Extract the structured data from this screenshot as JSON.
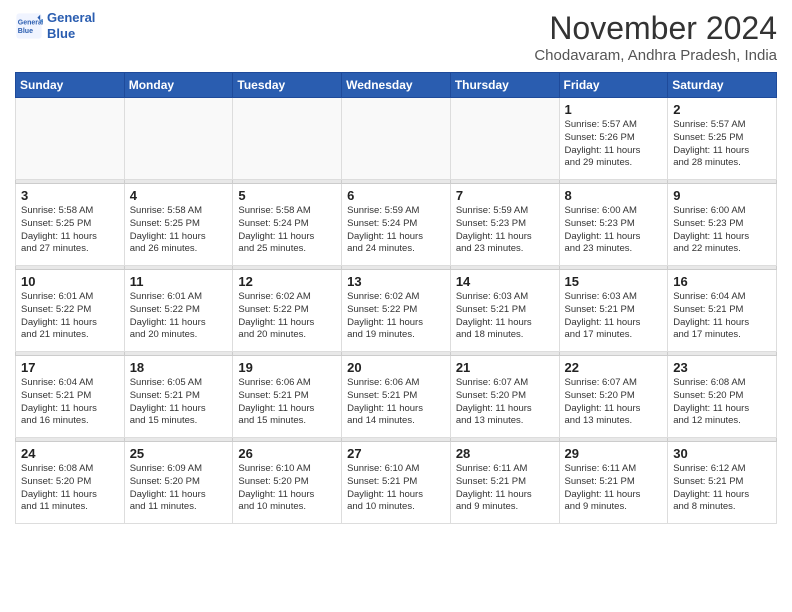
{
  "header": {
    "logo_line1": "General",
    "logo_line2": "Blue",
    "month_year": "November 2024",
    "location": "Chodavaram, Andhra Pradesh, India"
  },
  "weekdays": [
    "Sunday",
    "Monday",
    "Tuesday",
    "Wednesday",
    "Thursday",
    "Friday",
    "Saturday"
  ],
  "weeks": [
    [
      {
        "day": "",
        "info": ""
      },
      {
        "day": "",
        "info": ""
      },
      {
        "day": "",
        "info": ""
      },
      {
        "day": "",
        "info": ""
      },
      {
        "day": "",
        "info": ""
      },
      {
        "day": "1",
        "info": "Sunrise: 5:57 AM\nSunset: 5:26 PM\nDaylight: 11 hours\nand 29 minutes."
      },
      {
        "day": "2",
        "info": "Sunrise: 5:57 AM\nSunset: 5:25 PM\nDaylight: 11 hours\nand 28 minutes."
      }
    ],
    [
      {
        "day": "3",
        "info": "Sunrise: 5:58 AM\nSunset: 5:25 PM\nDaylight: 11 hours\nand 27 minutes."
      },
      {
        "day": "4",
        "info": "Sunrise: 5:58 AM\nSunset: 5:25 PM\nDaylight: 11 hours\nand 26 minutes."
      },
      {
        "day": "5",
        "info": "Sunrise: 5:58 AM\nSunset: 5:24 PM\nDaylight: 11 hours\nand 25 minutes."
      },
      {
        "day": "6",
        "info": "Sunrise: 5:59 AM\nSunset: 5:24 PM\nDaylight: 11 hours\nand 24 minutes."
      },
      {
        "day": "7",
        "info": "Sunrise: 5:59 AM\nSunset: 5:23 PM\nDaylight: 11 hours\nand 23 minutes."
      },
      {
        "day": "8",
        "info": "Sunrise: 6:00 AM\nSunset: 5:23 PM\nDaylight: 11 hours\nand 23 minutes."
      },
      {
        "day": "9",
        "info": "Sunrise: 6:00 AM\nSunset: 5:23 PM\nDaylight: 11 hours\nand 22 minutes."
      }
    ],
    [
      {
        "day": "10",
        "info": "Sunrise: 6:01 AM\nSunset: 5:22 PM\nDaylight: 11 hours\nand 21 minutes."
      },
      {
        "day": "11",
        "info": "Sunrise: 6:01 AM\nSunset: 5:22 PM\nDaylight: 11 hours\nand 20 minutes."
      },
      {
        "day": "12",
        "info": "Sunrise: 6:02 AM\nSunset: 5:22 PM\nDaylight: 11 hours\nand 20 minutes."
      },
      {
        "day": "13",
        "info": "Sunrise: 6:02 AM\nSunset: 5:22 PM\nDaylight: 11 hours\nand 19 minutes."
      },
      {
        "day": "14",
        "info": "Sunrise: 6:03 AM\nSunset: 5:21 PM\nDaylight: 11 hours\nand 18 minutes."
      },
      {
        "day": "15",
        "info": "Sunrise: 6:03 AM\nSunset: 5:21 PM\nDaylight: 11 hours\nand 17 minutes."
      },
      {
        "day": "16",
        "info": "Sunrise: 6:04 AM\nSunset: 5:21 PM\nDaylight: 11 hours\nand 17 minutes."
      }
    ],
    [
      {
        "day": "17",
        "info": "Sunrise: 6:04 AM\nSunset: 5:21 PM\nDaylight: 11 hours\nand 16 minutes."
      },
      {
        "day": "18",
        "info": "Sunrise: 6:05 AM\nSunset: 5:21 PM\nDaylight: 11 hours\nand 15 minutes."
      },
      {
        "day": "19",
        "info": "Sunrise: 6:06 AM\nSunset: 5:21 PM\nDaylight: 11 hours\nand 15 minutes."
      },
      {
        "day": "20",
        "info": "Sunrise: 6:06 AM\nSunset: 5:21 PM\nDaylight: 11 hours\nand 14 minutes."
      },
      {
        "day": "21",
        "info": "Sunrise: 6:07 AM\nSunset: 5:20 PM\nDaylight: 11 hours\nand 13 minutes."
      },
      {
        "day": "22",
        "info": "Sunrise: 6:07 AM\nSunset: 5:20 PM\nDaylight: 11 hours\nand 13 minutes."
      },
      {
        "day": "23",
        "info": "Sunrise: 6:08 AM\nSunset: 5:20 PM\nDaylight: 11 hours\nand 12 minutes."
      }
    ],
    [
      {
        "day": "24",
        "info": "Sunrise: 6:08 AM\nSunset: 5:20 PM\nDaylight: 11 hours\nand 11 minutes."
      },
      {
        "day": "25",
        "info": "Sunrise: 6:09 AM\nSunset: 5:20 PM\nDaylight: 11 hours\nand 11 minutes."
      },
      {
        "day": "26",
        "info": "Sunrise: 6:10 AM\nSunset: 5:20 PM\nDaylight: 11 hours\nand 10 minutes."
      },
      {
        "day": "27",
        "info": "Sunrise: 6:10 AM\nSunset: 5:21 PM\nDaylight: 11 hours\nand 10 minutes."
      },
      {
        "day": "28",
        "info": "Sunrise: 6:11 AM\nSunset: 5:21 PM\nDaylight: 11 hours\nand 9 minutes."
      },
      {
        "day": "29",
        "info": "Sunrise: 6:11 AM\nSunset: 5:21 PM\nDaylight: 11 hours\nand 9 minutes."
      },
      {
        "day": "30",
        "info": "Sunrise: 6:12 AM\nSunset: 5:21 PM\nDaylight: 11 hours\nand 8 minutes."
      }
    ]
  ]
}
